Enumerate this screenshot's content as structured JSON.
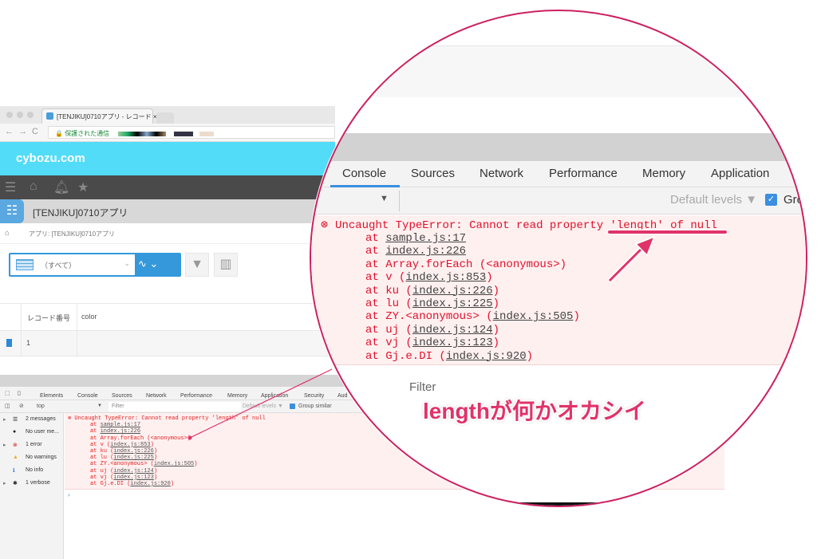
{
  "browser": {
    "tab_title": "[TENJIKU]0710アプリ - レコード ×",
    "secure_label": "保護された通信"
  },
  "app": {
    "brand": "cybozu.com",
    "app_title": "[TENJIKU]0710アプリ",
    "breadcrumb": "アプリ: [TENJIKU]0710アプリ",
    "view_select": "（すべて）",
    "table": {
      "headers": [
        "レコード番号",
        "color"
      ],
      "rows": [
        [
          "1",
          ""
        ]
      ]
    }
  },
  "devtools": {
    "tabs": [
      "Elements",
      "Console",
      "Sources",
      "Network",
      "Performance",
      "Memory",
      "Application",
      "Security",
      "Aud"
    ],
    "active_tab": "Console",
    "context": "top",
    "filter_placeholder": "Filter",
    "levels": "Default levels ▼",
    "group_similar": "Group similar",
    "group_similar_checked": true,
    "sidebar": [
      {
        "icon": "list-icon",
        "label": "2 messages"
      },
      {
        "icon": "user-icon",
        "label": "No user me..."
      },
      {
        "icon": "error-icon",
        "label": "1 error"
      },
      {
        "icon": "warning-icon",
        "label": "No warnings"
      },
      {
        "icon": "info-icon",
        "label": "No info"
      },
      {
        "icon": "bug-icon",
        "label": "1 verbose"
      }
    ],
    "error": {
      "message": "Uncaught TypeError: Cannot read property 'length' of null",
      "stack": [
        {
          "pre": "at ",
          "link": "sample.js:17",
          "post": ""
        },
        {
          "pre": "at ",
          "link": "index.js:226",
          "post": ""
        },
        {
          "pre": "at Array.forEach (<anonymous>)",
          "link": "",
          "post": ""
        },
        {
          "pre": "at v (",
          "link": "index.js:853",
          "post": ")"
        },
        {
          "pre": "at ku (",
          "link": "index.js:226",
          "post": ")"
        },
        {
          "pre": "at lu (",
          "link": "index.js:225",
          "post": ")"
        },
        {
          "pre": "at ZY.<anonymous> (",
          "link": "index.js:505",
          "post": ")"
        },
        {
          "pre": "at uj (",
          "link": "index.js:124",
          "post": ")"
        },
        {
          "pre": "at vj (",
          "link": "index.js:123",
          "post": ")"
        },
        {
          "pre": "at Gj.e.DI (",
          "link": "index.js:920",
          "post": ")"
        }
      ]
    },
    "prompt": "›"
  },
  "magnified": {
    "tabs": [
      "Console",
      "Sources",
      "Network",
      "Performance",
      "Memory",
      "Application"
    ],
    "filter_placeholder": "Filter",
    "levels": "Default levels ▼",
    "group_partial": "Gro"
  },
  "annotation": {
    "caption": "lengthが何かオカシイ",
    "color": "#e0336a"
  }
}
